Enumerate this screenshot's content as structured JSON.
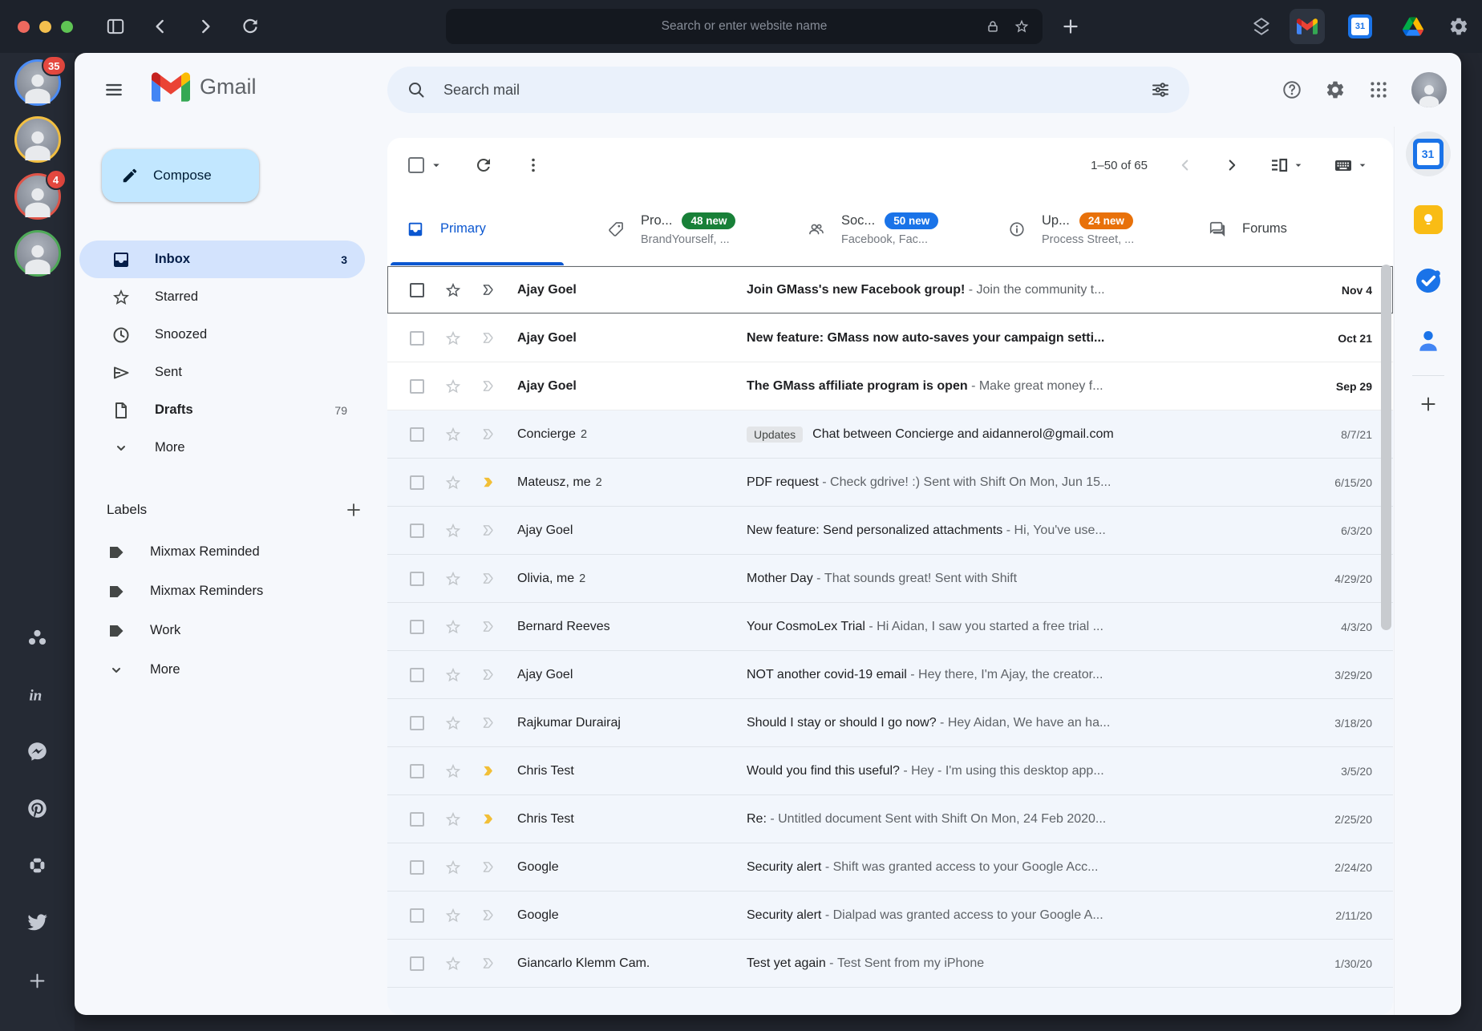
{
  "browser": {
    "url_placeholder": "Search or enter website name",
    "active_app": "gmail"
  },
  "rail": {
    "accounts": [
      {
        "ring": "#4c8df6",
        "badge": "35"
      },
      {
        "ring": "#f2bf42",
        "badge": ""
      },
      {
        "ring": "#df5448",
        "badge": "4"
      },
      {
        "ring": "#4faa59",
        "badge": ""
      }
    ],
    "apps": [
      "asana",
      "linkedin",
      "messenger",
      "pinterest",
      "slack",
      "twitter"
    ]
  },
  "gmail": {
    "logo": "Gmail",
    "search_placeholder": "Search mail",
    "compose_label": "Compose",
    "nav": [
      {
        "icon": "inbox",
        "label": "Inbox",
        "count": "3",
        "selected": true
      },
      {
        "icon": "star",
        "label": "Starred"
      },
      {
        "icon": "clock",
        "label": "Snoozed"
      },
      {
        "icon": "send",
        "label": "Sent"
      },
      {
        "icon": "draft",
        "label": "Drafts",
        "count": "79",
        "bold": true
      },
      {
        "icon": "chevron-down",
        "label": "More"
      }
    ],
    "labels_header": "Labels",
    "labels": [
      {
        "icon": "tag",
        "label": "Mixmax Reminded"
      },
      {
        "icon": "tag",
        "label": "Mixmax Reminders"
      },
      {
        "icon": "tag",
        "label": "Work"
      },
      {
        "icon": "chevron-down",
        "label": "More"
      }
    ],
    "toolbar": {
      "pagination": "1–50 of 65"
    },
    "tabs": [
      {
        "icon": "inbox",
        "label": "Primary",
        "selected": true
      },
      {
        "icon": "tag-outline",
        "label": "Pro...",
        "badge": "48 new",
        "badge_color": "#188038",
        "subtitle": "BrandYourself, ..."
      },
      {
        "icon": "people",
        "label": "Soc...",
        "badge": "50 new",
        "badge_color": "#1a73e8",
        "subtitle": "Facebook, Fac..."
      },
      {
        "icon": "info",
        "label": "Up...",
        "badge": "24 new",
        "badge_color": "#e8710a",
        "subtitle": "Process Street, ..."
      },
      {
        "icon": "forum",
        "label": "Forums"
      }
    ],
    "emails": [
      {
        "sender": "Ajay Goel",
        "subject": "Join GMass's new Facebook group!",
        "snippet": "Join the community t...",
        "date": "Nov 4",
        "unread": true,
        "focused": true
      },
      {
        "sender": "Ajay Goel",
        "subject": "New feature: GMass now auto-saves your campaign setti...",
        "date": "Oct 21",
        "unread": true
      },
      {
        "sender": "Ajay Goel",
        "subject": "The GMass affiliate program is open",
        "snippet": "Make great money f...",
        "date": "Sep 29",
        "unread": true
      },
      {
        "sender": "Concierge",
        "thread_count": "2",
        "chip": "Updates",
        "subject": "Chat between Concierge and aidannerol@gmail.com",
        "date": "8/7/21"
      },
      {
        "sender": "Mateusz, me",
        "thread_count": "2",
        "marker": true,
        "subject": "PDF request",
        "snippet": "Check gdrive! :) Sent with Shift On Mon, Jun 15...",
        "date": "6/15/20"
      },
      {
        "sender": "Ajay Goel",
        "subject": "New feature: Send personalized attachments",
        "snippet": "Hi, You've use...",
        "date": "6/3/20"
      },
      {
        "sender": "Olivia, me",
        "thread_count": "2",
        "subject": "Mother Day",
        "snippet": "That sounds great! Sent with Shift",
        "date": "4/29/20"
      },
      {
        "sender": "Bernard Reeves",
        "subject": "Your CosmoLex Trial",
        "snippet": "Hi Aidan, I saw you started a free trial ...",
        "date": "4/3/20"
      },
      {
        "sender": "Ajay Goel",
        "subject": "NOT another covid-19 email",
        "snippet": "Hey there, I'm Ajay, the creator...",
        "date": "3/29/20"
      },
      {
        "sender": "Rajkumar Durairaj",
        "subject": "Should I stay or should I go now?",
        "snippet": "Hey Aidan, We have an ha...",
        "date": "3/18/20"
      },
      {
        "sender": "Chris Test",
        "marker": true,
        "subject": "Would you find this useful?",
        "snippet": "Hey - I'm using this desktop app...",
        "date": "3/5/20"
      },
      {
        "sender": "Chris Test",
        "marker": true,
        "subject": "Re:",
        "snippet": "Untitled document Sent with Shift On Mon, 24 Feb 2020...",
        "date": "2/25/20"
      },
      {
        "sender": "Google",
        "subject": "Security alert",
        "snippet": "Shift was granted access to your Google Acc...",
        "date": "2/24/20"
      },
      {
        "sender": "Google",
        "subject": "Security alert",
        "snippet": "Dialpad was granted access to your Google A...",
        "date": "2/11/20"
      },
      {
        "sender": "Giancarlo Klemm Cam.",
        "subject": "Test yet again",
        "snippet": "Test Sent from my iPhone",
        "date": "1/30/20"
      }
    ]
  },
  "side_panel": {
    "apps": [
      "calendar",
      "keep",
      "tasks",
      "contacts"
    ],
    "calendar_day": "31"
  }
}
